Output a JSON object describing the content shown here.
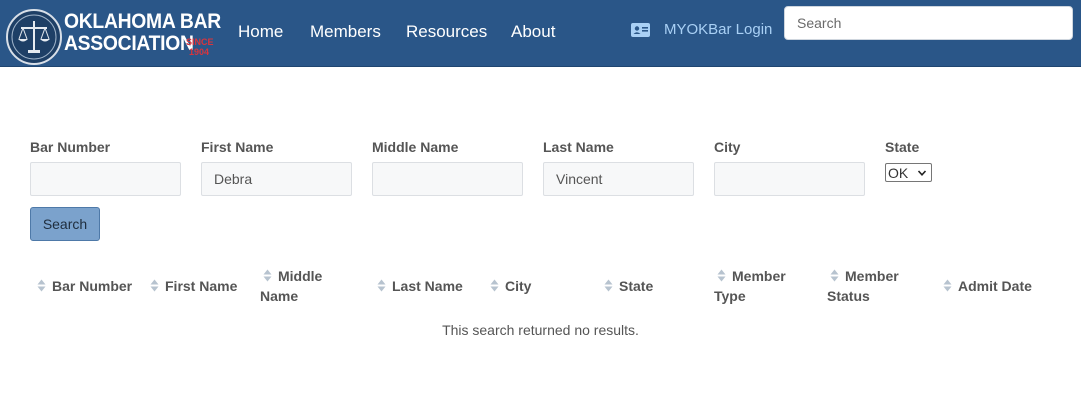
{
  "header": {
    "logo": {
      "line1": "OKLAHOMA BAR",
      "line2": "ASSOCIATION",
      "since": "SINCE 1904"
    },
    "nav": [
      {
        "label": "Home"
      },
      {
        "label": "Members"
      },
      {
        "label": "Resources"
      },
      {
        "label": "About"
      }
    ],
    "login_label": "MYOKBar Login",
    "login_icon": "id-card-icon",
    "search_placeholder": "Search"
  },
  "form": {
    "fields": [
      {
        "label": "Bar Number",
        "value": ""
      },
      {
        "label": "First Name",
        "value": "Debra"
      },
      {
        "label": "Middle Name",
        "value": ""
      },
      {
        "label": "Last Name",
        "value": "Vincent"
      },
      {
        "label": "City",
        "value": ""
      }
    ],
    "state": {
      "label": "State",
      "selected": "OK"
    },
    "search_button": "Search"
  },
  "results": {
    "columns": [
      {
        "label": "Bar Number"
      },
      {
        "label": "First Name"
      },
      {
        "label": "Middle Name"
      },
      {
        "label": "Last Name"
      },
      {
        "label": "City"
      },
      {
        "label": "State"
      },
      {
        "label": "Member Type"
      },
      {
        "label": "Member Status"
      },
      {
        "label": "Admit Date"
      }
    ],
    "sort_icon": "sort-icon",
    "empty_message": "This search returned no results."
  },
  "colors": {
    "header_bg": "#2a5688",
    "login_text": "#a9d0f5",
    "button_bg": "#7ba2cc",
    "since_red": "#d9343c"
  }
}
